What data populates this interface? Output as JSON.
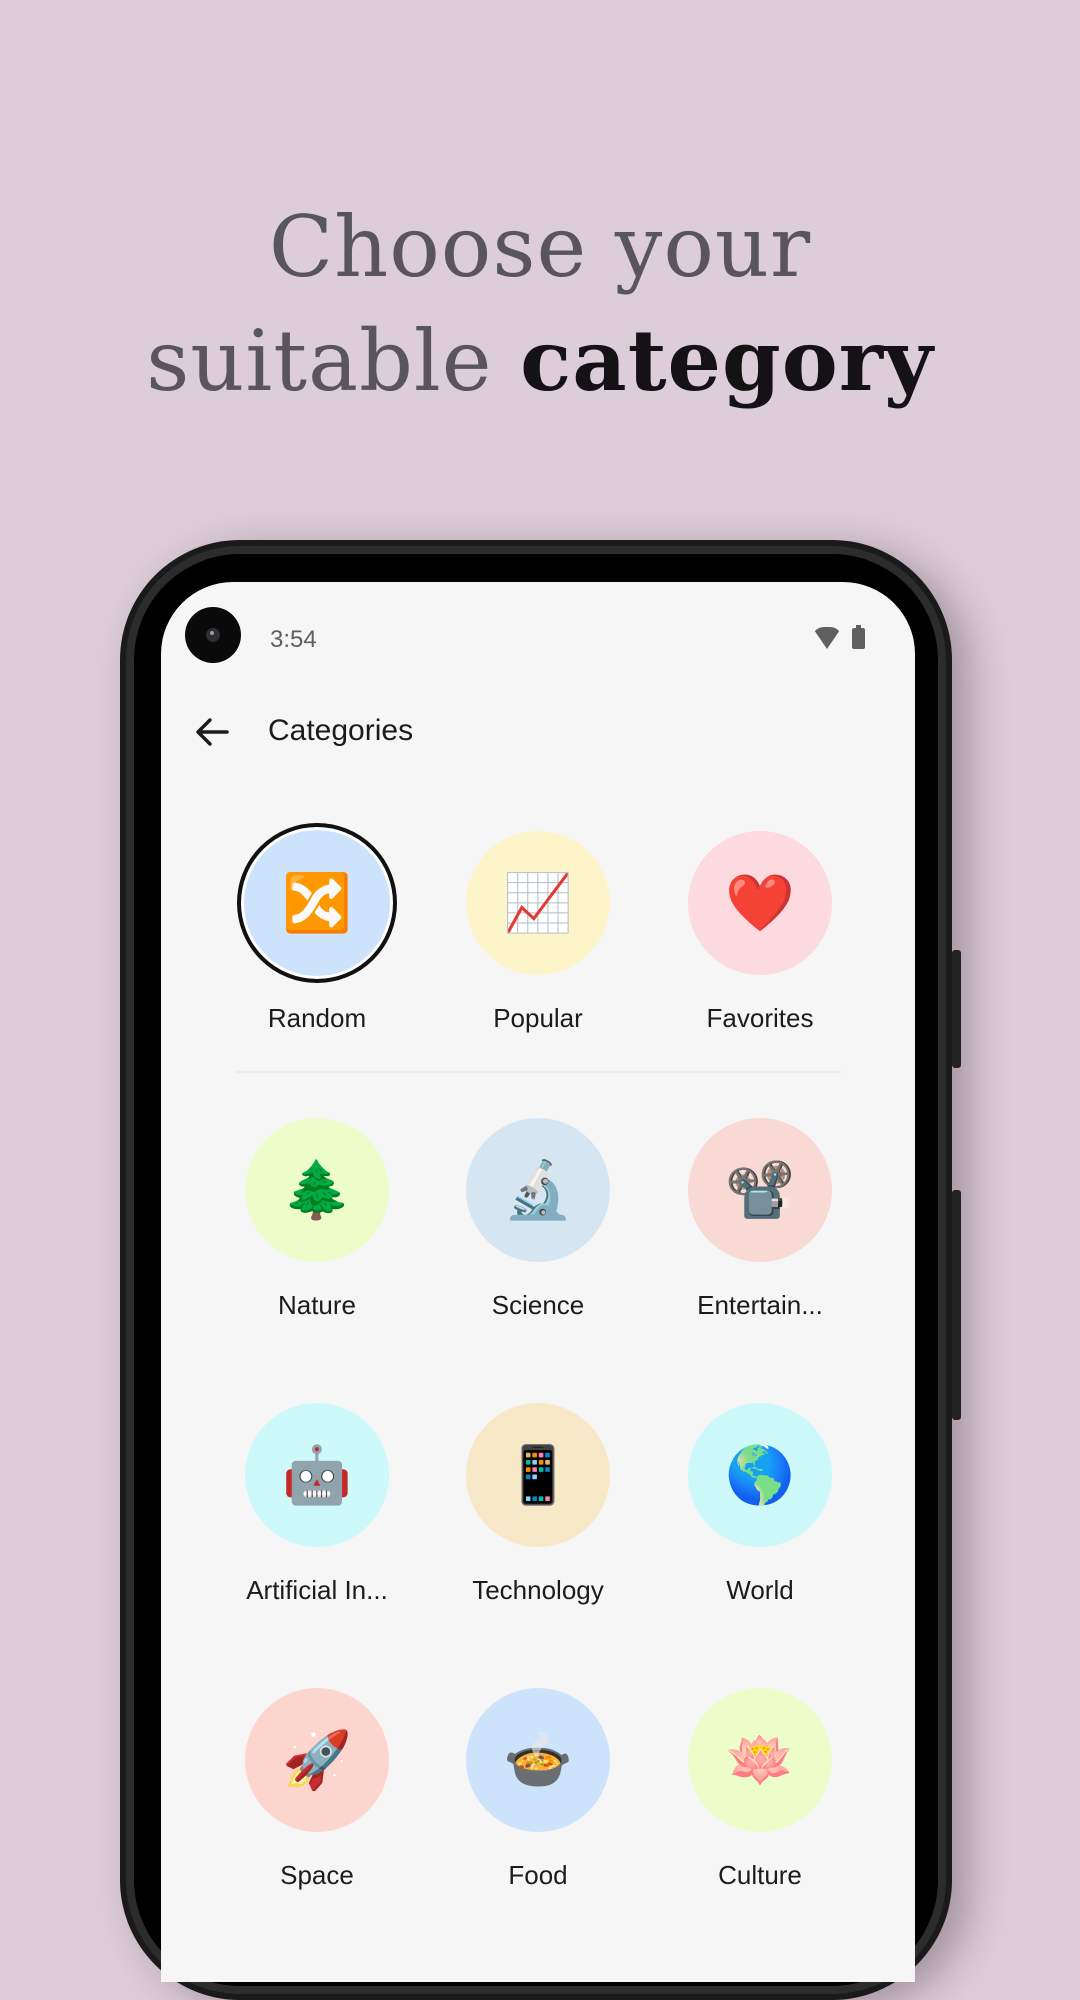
{
  "headline": {
    "line1": "Choose your",
    "line2_regular": "suitable ",
    "line2_bold": "category"
  },
  "status_bar": {
    "time": "3:54",
    "icons": [
      "wifi-icon",
      "battery-icon"
    ]
  },
  "app_bar": {
    "back_icon": "arrow-left-icon",
    "title": "Categories"
  },
  "categories": [
    {
      "label": "Random",
      "emoji": "🔀",
      "color": "#cde3fb",
      "selected": true
    },
    {
      "label": "Popular",
      "emoji": "📈",
      "color": "#fdf5c9",
      "selected": false
    },
    {
      "label": "Favorites",
      "emoji": "❤️",
      "color": "#fdd9e0",
      "selected": false
    },
    {
      "label": "Nature",
      "emoji": "🌲",
      "color": "#ecfdc9",
      "selected": false
    },
    {
      "label": "Science",
      "emoji": "🔬",
      "color": "#d5e6f2",
      "selected": false
    },
    {
      "label": "Entertain...",
      "emoji": "📽️",
      "color": "#f8d9d4",
      "selected": false
    },
    {
      "label": "Artificial In...",
      "emoji": "🤖",
      "color": "#cdf9fb",
      "selected": false
    },
    {
      "label": "Technology",
      "emoji": "📱",
      "color": "#f7e8c8",
      "selected": false
    },
    {
      "label": "World",
      "emoji": "🌎",
      "color": "#cdf9fb",
      "selected": false
    },
    {
      "label": "Space",
      "emoji": "🚀",
      "color": "#fdd5cf",
      "selected": false
    },
    {
      "label": "Food",
      "emoji": "🍲",
      "color": "#cde3fb",
      "selected": false
    },
    {
      "label": "Culture",
      "emoji": "🪷",
      "color": "#ecfdc9",
      "selected": false
    }
  ],
  "colors": {
    "background": "#dccdd8",
    "screen": "#f6f6f6",
    "selected_ring": "#111111"
  }
}
